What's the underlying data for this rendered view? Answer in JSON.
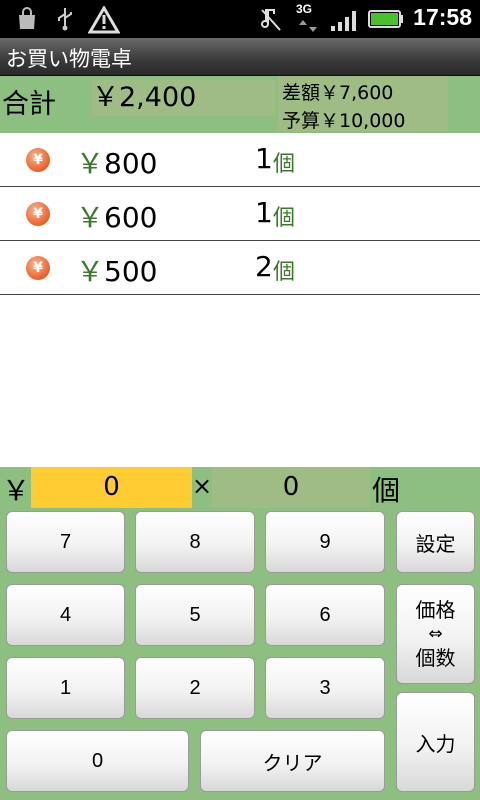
{
  "status_bar": {
    "time": "17:58",
    "network": "3G",
    "icons": [
      "shopping-bag-icon",
      "usb-icon",
      "warning-icon",
      "mute-icon",
      "signal-icon",
      "battery-icon"
    ]
  },
  "app": {
    "title": "お買い物電卓"
  },
  "summary": {
    "total_label": "合計",
    "total_value": "￥2,400",
    "difference": "差額￥7,600",
    "budget": "予算￥10,000"
  },
  "items": [
    {
      "price": "800",
      "qty": "1",
      "unit": "個"
    },
    {
      "price": "600",
      "qty": "1",
      "unit": "個"
    },
    {
      "price": "500",
      "qty": "2",
      "unit": "個"
    }
  ],
  "currency_symbol": "￥",
  "coin_glyph": "¥",
  "input": {
    "yen": "￥",
    "price_value": "0",
    "times": "×",
    "qty_value": "0",
    "unit": "個"
  },
  "keypad": {
    "k7": "7",
    "k8": "8",
    "k9": "9",
    "k4": "4",
    "k5": "5",
    "k6": "6",
    "k1": "1",
    "k2": "2",
    "k3": "3",
    "k0": "0",
    "clear": "クリア",
    "settings": "設定",
    "swap_line1": "価格",
    "swap_line2": "⇔",
    "swap_line3": "個数",
    "enter": "入力"
  },
  "colors": {
    "accent_green": "#8dbf80",
    "price_field": "#ffcc33",
    "unit_green": "#3a7a2a"
  }
}
